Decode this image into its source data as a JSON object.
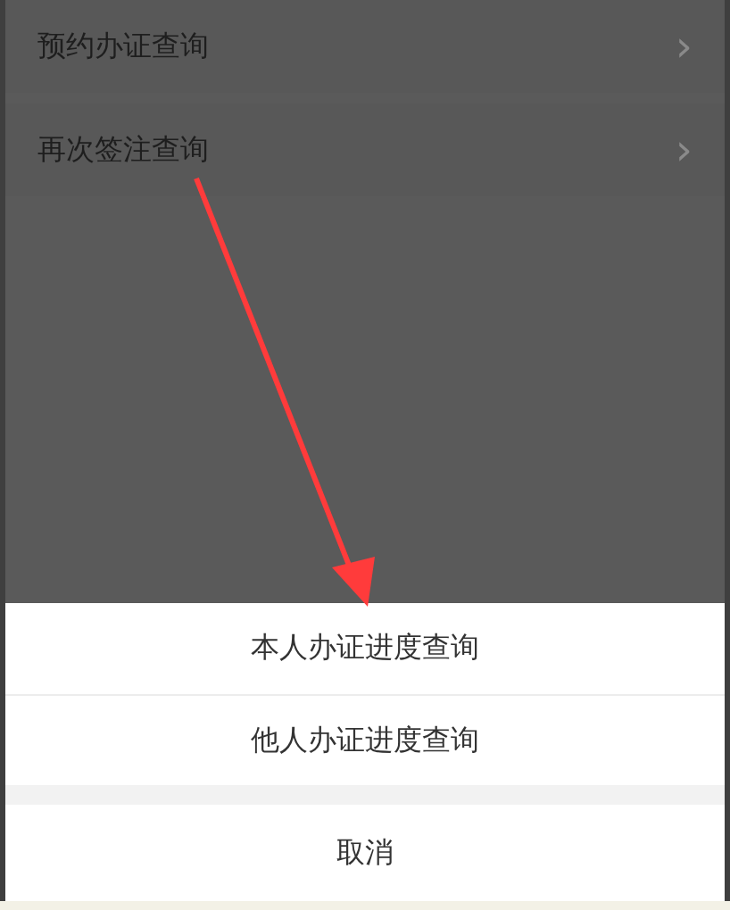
{
  "list": [
    {
      "label": "预约办证查询",
      "chevron": "›"
    },
    {
      "label": "再次签注查询",
      "chevron": "›"
    }
  ],
  "action_sheet": {
    "options": [
      "本人办证进度查询",
      "他人办证进度查询"
    ],
    "cancel": "取消"
  }
}
